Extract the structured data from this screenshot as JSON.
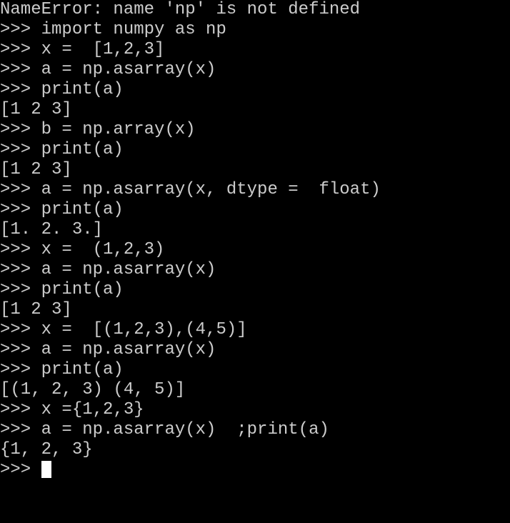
{
  "lines": [
    {
      "type": "error",
      "prompt": "",
      "text": "NameError: name 'np' is not defined"
    },
    {
      "type": "input",
      "prompt": ">>> ",
      "text": "import numpy as np"
    },
    {
      "type": "input",
      "prompt": ">>> ",
      "text": "x =  [1,2,3]"
    },
    {
      "type": "input",
      "prompt": ">>> ",
      "text": "a = np.asarray(x)"
    },
    {
      "type": "input",
      "prompt": ">>> ",
      "text": "print(a)"
    },
    {
      "type": "output",
      "prompt": "",
      "text": "[1 2 3]"
    },
    {
      "type": "input",
      "prompt": ">>> ",
      "text": "b = np.array(x)"
    },
    {
      "type": "input",
      "prompt": ">>> ",
      "text": "print(a)"
    },
    {
      "type": "output",
      "prompt": "",
      "text": "[1 2 3]"
    },
    {
      "type": "input",
      "prompt": ">>> ",
      "text": "a = np.asarray(x, dtype =  float)"
    },
    {
      "type": "input",
      "prompt": ">>> ",
      "text": "print(a)"
    },
    {
      "type": "output",
      "prompt": "",
      "text": "[1. 2. 3.]"
    },
    {
      "type": "input",
      "prompt": ">>> ",
      "text": "x =  (1,2,3)"
    },
    {
      "type": "input",
      "prompt": ">>> ",
      "text": "a = np.asarray(x)"
    },
    {
      "type": "input",
      "prompt": ">>> ",
      "text": "print(a)"
    },
    {
      "type": "output",
      "prompt": "",
      "text": "[1 2 3]"
    },
    {
      "type": "input",
      "prompt": ">>> ",
      "text": "x =  [(1,2,3),(4,5)]"
    },
    {
      "type": "input",
      "prompt": ">>> ",
      "text": "a = np.asarray(x)"
    },
    {
      "type": "input",
      "prompt": ">>> ",
      "text": "print(a)"
    },
    {
      "type": "output",
      "prompt": "",
      "text": "[(1, 2, 3) (4, 5)]"
    },
    {
      "type": "input",
      "prompt": ">>> ",
      "text": "x ={1,2,3}"
    },
    {
      "type": "input",
      "prompt": ">>> ",
      "text": "a = np.asarray(x)  ;print(a)"
    },
    {
      "type": "output",
      "prompt": "",
      "text": "{1, 2, 3}"
    },
    {
      "type": "input",
      "prompt": ">>> ",
      "text": "",
      "cursor": true
    }
  ]
}
